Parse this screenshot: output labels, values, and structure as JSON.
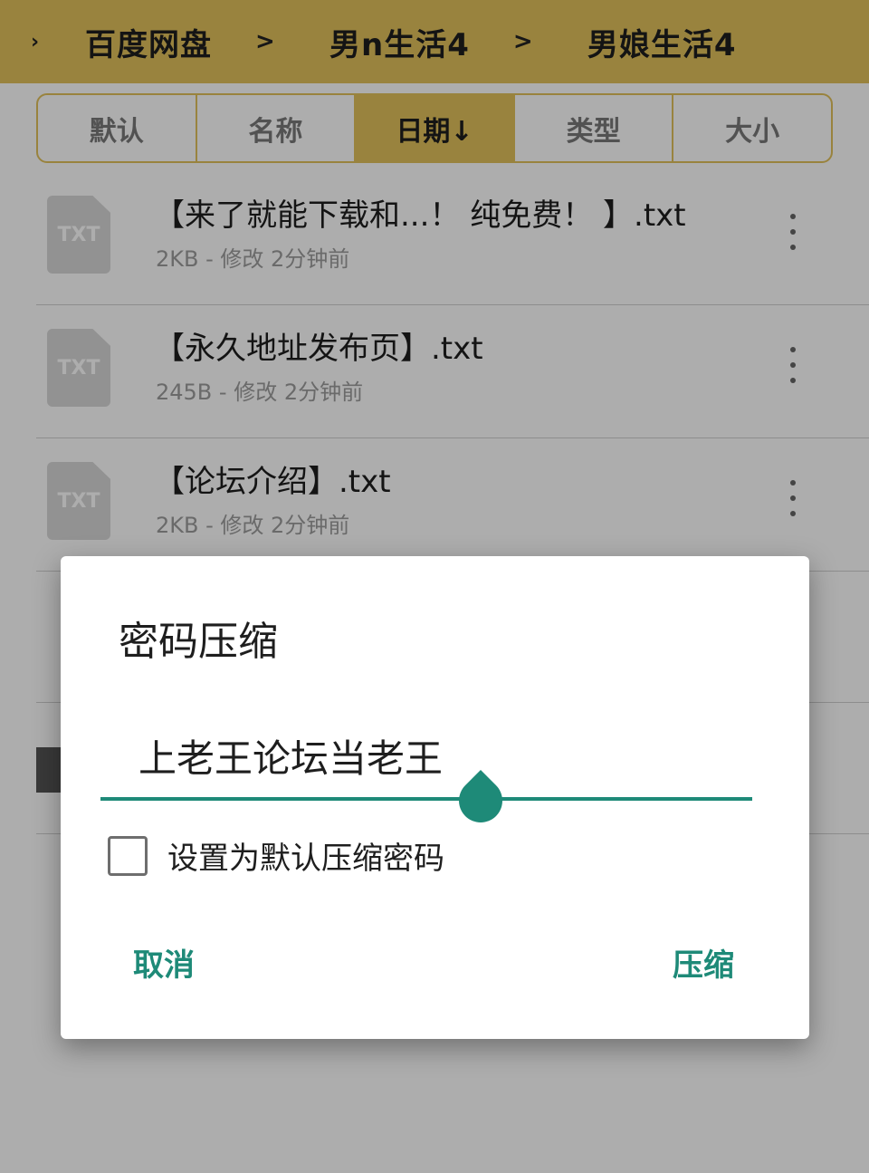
{
  "breadcrumb": {
    "items": [
      "百度网盘",
      "男n生活4",
      "男娘生活4"
    ]
  },
  "sort": {
    "options": [
      "默认",
      "名称",
      "日期↓",
      "类型",
      "大小"
    ],
    "active": "日期↓"
  },
  "files": [
    {
      "icon": "TXT",
      "name": "【来了就能下载和...！ 纯免费！ 】.txt",
      "meta": "2KB - 修改 2分钟前"
    },
    {
      "icon": "TXT",
      "name": "【永久地址发布页】.txt",
      "meta": "245B - 修改 2分钟前"
    },
    {
      "icon": "TXT",
      "name": "【论坛介绍】.txt",
      "meta": "2KB - 修改 2分钟前"
    }
  ],
  "dialog": {
    "title": "密码压缩",
    "password_value": "上老王论坛当老王",
    "checkbox_label": "设置为默认压缩密码",
    "checkbox_checked": false,
    "cancel_label": "取消",
    "confirm_label": "压缩"
  },
  "colors": {
    "accent": "#1e8a78",
    "header": "#e2c15c"
  }
}
